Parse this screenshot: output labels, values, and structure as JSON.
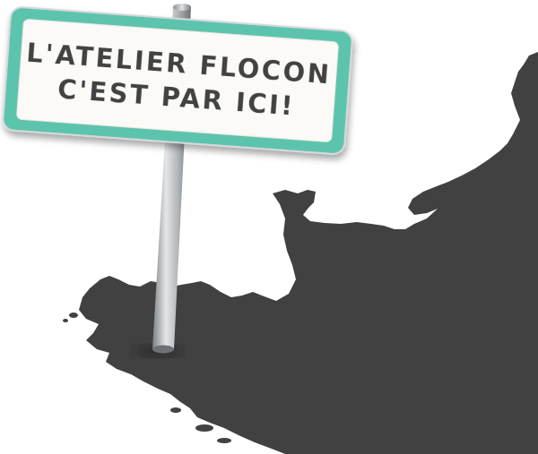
{
  "sign": {
    "line1": "L'ATELIER FLOCON",
    "line2": "C'EST PAR ICI!"
  },
  "colors": {
    "sign_border": "#5cc4ad",
    "sign_face": "#fbfaf7",
    "land": "#414141",
    "pole": "#b9bcbf",
    "text": "#434343"
  }
}
